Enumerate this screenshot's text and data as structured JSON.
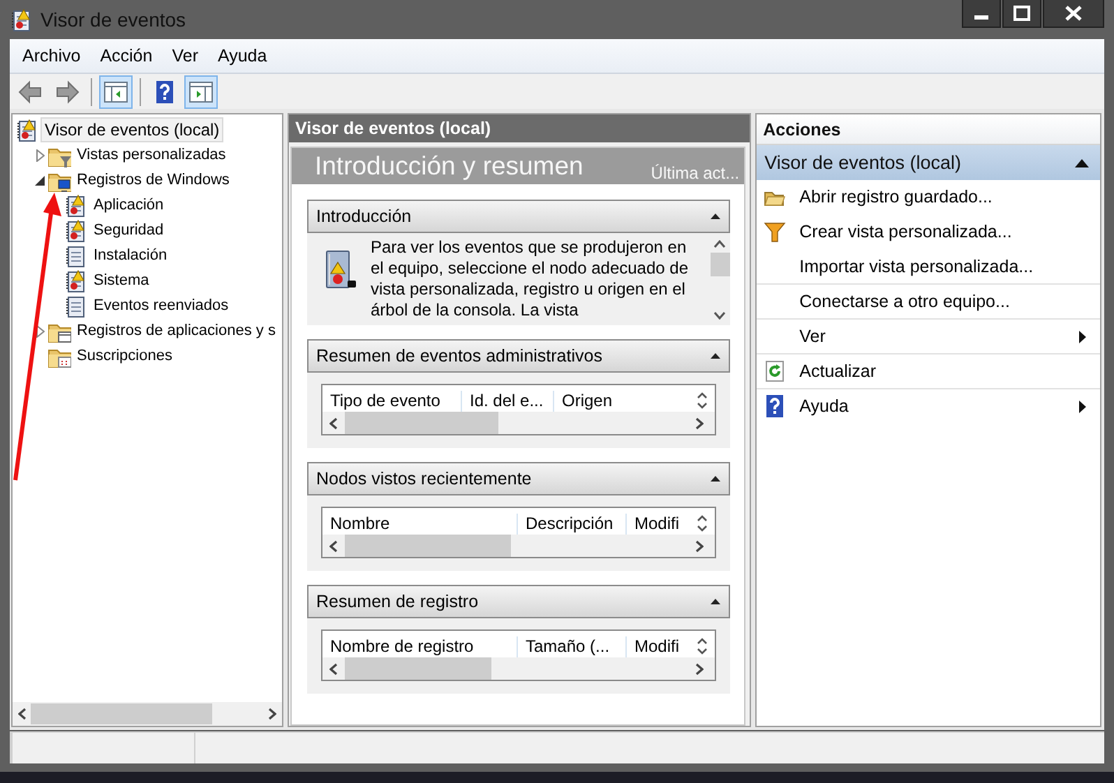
{
  "window": {
    "title": "Visor de eventos"
  },
  "menu": [
    {
      "label": "Archivo"
    },
    {
      "label": "Acción"
    },
    {
      "label": "Ver"
    },
    {
      "label": "Ayuda"
    }
  ],
  "toolbar": [
    {
      "kind": "back",
      "pressed": false
    },
    {
      "kind": "forward",
      "pressed": false
    },
    {
      "kind": "separator"
    },
    {
      "kind": "tree-toggle",
      "pressed": true
    },
    {
      "kind": "separator"
    },
    {
      "kind": "help",
      "pressed": false
    },
    {
      "kind": "actions-toggle",
      "pressed": true
    }
  ],
  "tree": [
    {
      "label": "Visor de eventos (local)",
      "kind": "log-warning",
      "selected": true,
      "children": [
        {
          "label": "Vistas personalizadas",
          "kind": "folder-filter",
          "selected": false,
          "expanded": false
        },
        {
          "label": "Registros de Windows",
          "kind": "folder-computer",
          "selected": false,
          "expanded": true,
          "children": [
            {
              "label": "Aplicación",
              "kind": "log-warning",
              "selected": false
            },
            {
              "label": "Seguridad",
              "kind": "log-warning",
              "selected": false
            },
            {
              "label": "Instalación",
              "kind": "log-plain",
              "selected": false
            },
            {
              "label": "Sistema",
              "kind": "log-warning",
              "selected": false
            },
            {
              "label": "Eventos reenviados",
              "kind": "log-plain",
              "selected": false
            }
          ]
        },
        {
          "label": "Registros de aplicaciones y s",
          "kind": "folder-window",
          "selected": false,
          "expanded": false
        },
        {
          "label": "Suscripciones",
          "kind": "folder-calendar",
          "selected": false
        }
      ]
    }
  ],
  "center": {
    "header": "Visor de eventos (local)",
    "title": "Introducción y resumen",
    "updated": "Última act...",
    "sections": [
      {
        "kind": "text",
        "title": "Introducción",
        "expanded": true,
        "text": "Para ver los eventos que se produjeron en el equipo, seleccione el nodo adecuado de vista personalizada, registro u origen en el árbol de la consola. La vista"
      },
      {
        "kind": "table",
        "title": "Resumen de eventos administrativos",
        "expanded": true,
        "columns": [
          "Tipo de evento",
          "Id. del e...",
          "Origen"
        ]
      },
      {
        "kind": "table",
        "title": "Nodos vistos recientemente",
        "expanded": true,
        "columns": [
          "Nombre",
          "Descripción",
          "Modifi"
        ]
      },
      {
        "kind": "table",
        "title": "Resumen de registro",
        "expanded": true,
        "columns": [
          "Nombre de registro",
          "Tamaño (...",
          "Modifi"
        ]
      }
    ]
  },
  "actions": {
    "title": "Acciones",
    "group": {
      "title": "Visor de eventos (local)",
      "expanded": true
    },
    "items": [
      {
        "label": "Abrir registro guardado...",
        "kind": "folder",
        "submenu": false,
        "divider": false
      },
      {
        "label": "Crear vista personalizada...",
        "kind": "filter",
        "submenu": false,
        "divider": false
      },
      {
        "label": "Importar vista personalizada...",
        "kind": "none",
        "submenu": false,
        "divider": true
      },
      {
        "label": "Conectarse a otro equipo...",
        "kind": "none",
        "submenu": false,
        "divider": true
      },
      {
        "label": "Ver",
        "kind": "none",
        "submenu": true,
        "divider": true
      },
      {
        "label": "Actualizar",
        "kind": "refresh",
        "submenu": false,
        "divider": true
      },
      {
        "label": "Ayuda",
        "kind": "help",
        "submenu": true,
        "divider": false
      }
    ]
  },
  "annotation": {
    "kind": "arrow"
  }
}
